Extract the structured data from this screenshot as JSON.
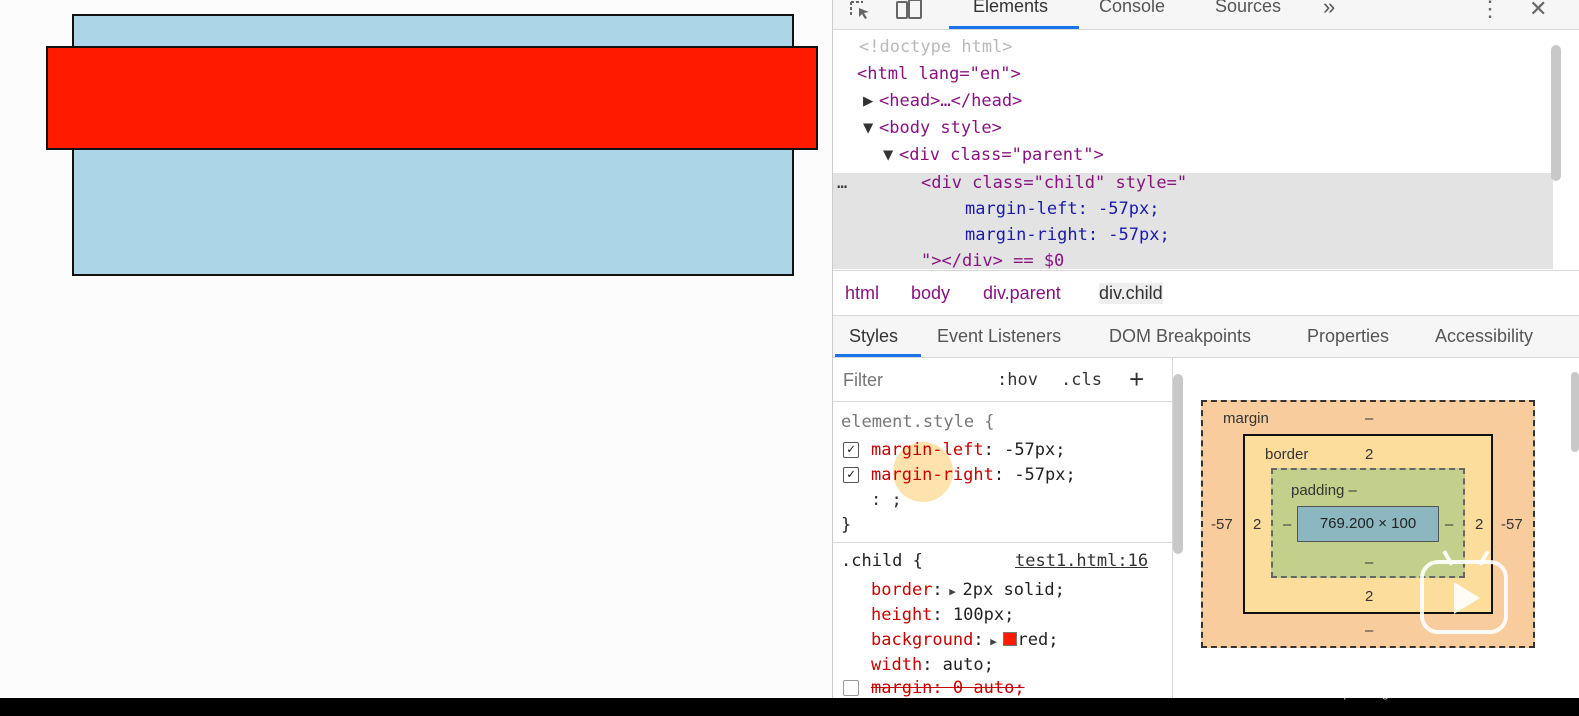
{
  "devtools": {
    "tabs": [
      "Elements",
      "Console",
      "Sources"
    ],
    "more_tabs": "»",
    "dom": {
      "doctype": "<!doctype html>",
      "html_open": "<html lang=\"en\">",
      "head": "<head>…</head>",
      "body": "<body style>",
      "parent_div": "<div class=\"parent\">",
      "child_div": "<div class=\"child\" style=\"",
      "margin_left_decl": "margin-left: -57px;",
      "margin_right_decl": "margin-right: -57px;",
      "child_close": "\"></div> == $0",
      "ellipsis": "…"
    },
    "breadcrumbs": [
      "html",
      "body",
      "div.parent",
      "div.child"
    ],
    "subtabs": [
      "Styles",
      "Event Listeners",
      "DOM Breakpoints",
      "Properties",
      "Accessibility"
    ],
    "styles": {
      "filter_placeholder": "Filter",
      "hov": ":hov",
      "cls": ".cls",
      "plus": "+",
      "element_style_selector": "element.style {",
      "element_style_rules": [
        {
          "prop": "margin-left",
          "value": "-57px;"
        },
        {
          "prop": "margin-right",
          "value": "-57px;"
        }
      ],
      "editing_line": ": ;",
      "close_brace": "}",
      "child_selector": ".child {",
      "child_source": "test1.html:16",
      "child_rules": [
        {
          "prop": "border",
          "value": "2px solid;"
        },
        {
          "prop": "height",
          "value": "100px;"
        },
        {
          "prop": "background",
          "value": "red;"
        },
        {
          "prop": "width",
          "value": "auto;"
        },
        {
          "prop": "margin",
          "value": "0 auto;"
        }
      ]
    },
    "box_model": {
      "margin_label": "margin",
      "margin_top": "–",
      "margin_left": "-57",
      "margin_right": "-57",
      "margin_bottom": "–",
      "border_label": "border",
      "border_top": "2",
      "border_left": "2",
      "border_right": "2",
      "border_bottom": "2",
      "padding_label": "padding –",
      "padding_left": "–",
      "padding_right": "–",
      "padding_bottom": "–",
      "content": "769.200 × 100"
    }
  },
  "colors": {
    "parent_bg": "#acd6e7",
    "child_bg": "#ff1a00",
    "accent": "#1a73e8"
  },
  "watermark": {
    "url": "https://blog.csdn.net/andmirdinck"
  }
}
